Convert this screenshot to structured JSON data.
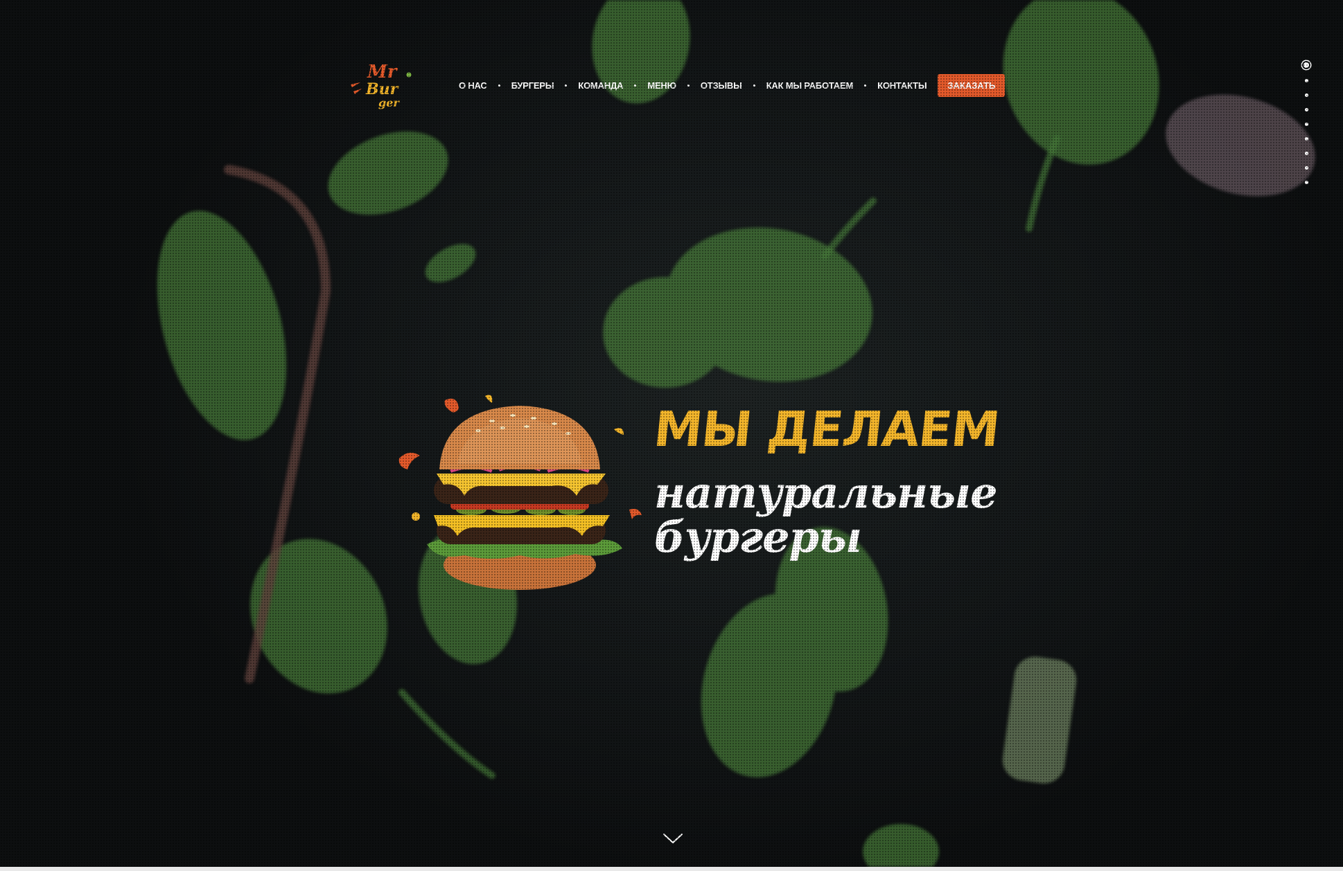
{
  "brand": {
    "logo_text_line1": "Mr",
    "logo_text_line2": "Bur",
    "logo_text_line3": "ger"
  },
  "nav": {
    "items": [
      {
        "label": "О НАС"
      },
      {
        "label": "БУРГЕРЫ"
      },
      {
        "label": "КОМАНДА"
      },
      {
        "label": "МЕНЮ"
      },
      {
        "label": "ОТЗЫВЫ"
      },
      {
        "label": "КАК МЫ РАБОТАЕМ"
      },
      {
        "label": "КОНТАКТЫ"
      }
    ],
    "order_button": "ЗАКАЗАТЬ"
  },
  "hero": {
    "headline_top": "МЫ ДЕЛАЕМ",
    "headline_line2": "натуральные",
    "headline_line3": "бургеры"
  },
  "pager": {
    "count": 9,
    "active_index": 0
  },
  "colors": {
    "accent_orange": "#e35a2b",
    "headline_yellow": "#f4b62b",
    "background": "#0f1112"
  },
  "icons": {
    "scroll_down": "chevron-down-icon"
  }
}
